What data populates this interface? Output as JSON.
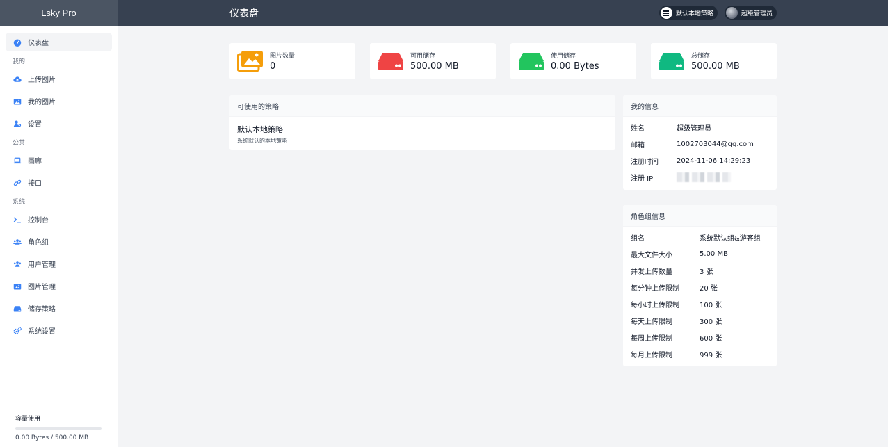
{
  "app": {
    "brand": "Lsky Pro"
  },
  "header": {
    "title": "仪表盘",
    "strategy_label": "默认本地策略",
    "user_label": "超级管理员"
  },
  "sidebar": {
    "dashboard": "仪表盘",
    "section_mine": "我的",
    "upload": "上传图片",
    "my_images": "我的图片",
    "settings": "设置",
    "section_public": "公共",
    "gallery": "画廊",
    "api": "接口",
    "section_system": "系统",
    "console": "控制台",
    "roles": "角色组",
    "user_mgmt": "用户管理",
    "image_mgmt": "图片管理",
    "storage_strategy": "储存策略",
    "system_settings": "系统设置"
  },
  "usage": {
    "title": "容量使用",
    "text": "0.00 Bytes / 500.00 MB",
    "fraction": 0
  },
  "stats": [
    {
      "label": "图片数量",
      "value": "0",
      "icon": "images-icon",
      "color": "#f59e0b"
    },
    {
      "label": "可用储存",
      "value": "500.00 MB",
      "icon": "hdd-icon",
      "color": "#ef4444"
    },
    {
      "label": "使用储存",
      "value": "0.00 Bytes",
      "icon": "hdd-icon",
      "color": "#22c55e"
    },
    {
      "label": "总储存",
      "value": "500.00 MB",
      "icon": "hdd-icon",
      "color": "#10b981"
    }
  ],
  "strategies": {
    "title": "可使用的策略",
    "items": [
      {
        "name": "默认本地策略",
        "desc": "系统默认的本地策略"
      }
    ]
  },
  "my_info": {
    "title": "我的信息",
    "rows": [
      {
        "k": "姓名",
        "v": "超级管理员"
      },
      {
        "k": "邮箱",
        "v": "1002703044@qq.com"
      },
      {
        "k": "注册时间",
        "v": "2024-11-06 14:29:23"
      },
      {
        "k": "注册 IP",
        "v": ""
      }
    ]
  },
  "role_info": {
    "title": "角色组信息",
    "rows": [
      {
        "k": "组名",
        "v": "系统默认组&游客组"
      },
      {
        "k": "最大文件大小",
        "v": "5.00 MB"
      },
      {
        "k": "并发上传数量",
        "v": "3 张"
      },
      {
        "k": "每分钟上传限制",
        "v": "20 张"
      },
      {
        "k": "每小时上传限制",
        "v": "100 张"
      },
      {
        "k": "每天上传限制",
        "v": "300 张"
      },
      {
        "k": "每周上传限制",
        "v": "600 张"
      },
      {
        "k": "每月上传限制",
        "v": "999 张"
      }
    ]
  }
}
